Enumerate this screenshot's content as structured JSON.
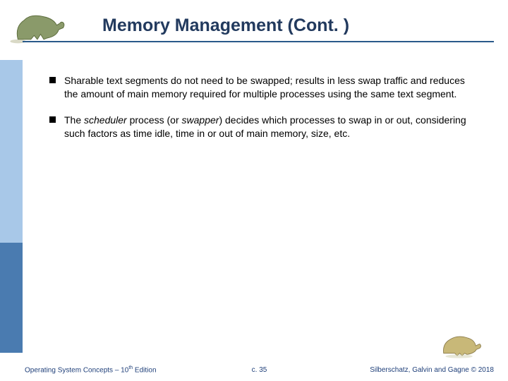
{
  "title": "Memory Management (Cont. )",
  "bullets": [
    {
      "pre": "Sharable text segments do not need to be swapped; results in less swap traffic and reduces the amount of main memory required for multiple processes using the same text segment."
    },
    {
      "pre": "The ",
      "italic1": "scheduler ",
      "mid1": "process (or ",
      "italic2": "swapper",
      "post": ") decides which processes to swap in or out, considering such factors as time idle, time in or out of main memory, size, etc."
    }
  ],
  "footer": {
    "left_pre": "Operating System Concepts – 10",
    "left_sup": "th",
    "left_post": " Edition",
    "center": "c. 35",
    "right": "Silberschatz, Galvin and Gagne © 2018"
  },
  "icons": {
    "dino_top": "dinosaur-logo-top",
    "dino_bottom": "dinosaur-logo-bottom"
  }
}
